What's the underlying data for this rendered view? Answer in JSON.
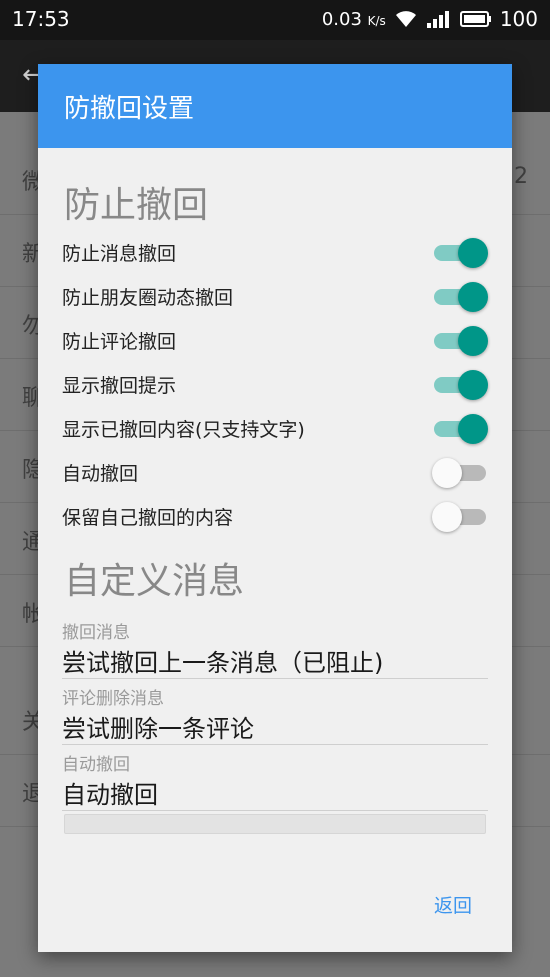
{
  "status_bar": {
    "time": "17:53",
    "network_speed": "0.03",
    "network_unit": "K/s",
    "battery": "100",
    "icons": [
      "wifi-icon",
      "signal-icon",
      "battery-icon"
    ]
  },
  "background": {
    "rows": [
      {
        "label": "微",
        "tail": "2"
      },
      {
        "label": "新",
        "tail": ""
      },
      {
        "label": "勿",
        "tail": ""
      },
      {
        "label": "聊",
        "tail": ""
      },
      {
        "label": "隐",
        "tail": ""
      },
      {
        "label": "通",
        "tail": ""
      },
      {
        "label": "帐",
        "tail": ""
      },
      {
        "label": "关",
        "tail": ""
      },
      {
        "label": "退",
        "tail": ""
      }
    ]
  },
  "dialog": {
    "title": "防撤回设置",
    "section_prevent": "防止撤回",
    "toggles": [
      {
        "label": "防止消息撤回",
        "on": true
      },
      {
        "label": "防止朋友圈动态撤回",
        "on": true
      },
      {
        "label": "防止评论撤回",
        "on": true
      },
      {
        "label": "显示撤回提示",
        "on": true
      },
      {
        "label": "显示已撤回内容(只支持文字)",
        "on": true
      },
      {
        "label": "自动撤回",
        "on": false
      },
      {
        "label": "保留自己撤回的内容",
        "on": false
      }
    ],
    "section_custom": "自定义消息",
    "fields": [
      {
        "label": "撤回消息",
        "value": "尝试撤回上一条消息（已阻止)"
      },
      {
        "label": "评论删除消息",
        "value": "尝试删除一条评论"
      },
      {
        "label": "自动撤回",
        "value": "自动撤回"
      }
    ],
    "back_label": "返回"
  },
  "colors": {
    "accent": "#3c95ee",
    "switch_on": "#009688",
    "switch_track_on": "#80cbc4"
  }
}
